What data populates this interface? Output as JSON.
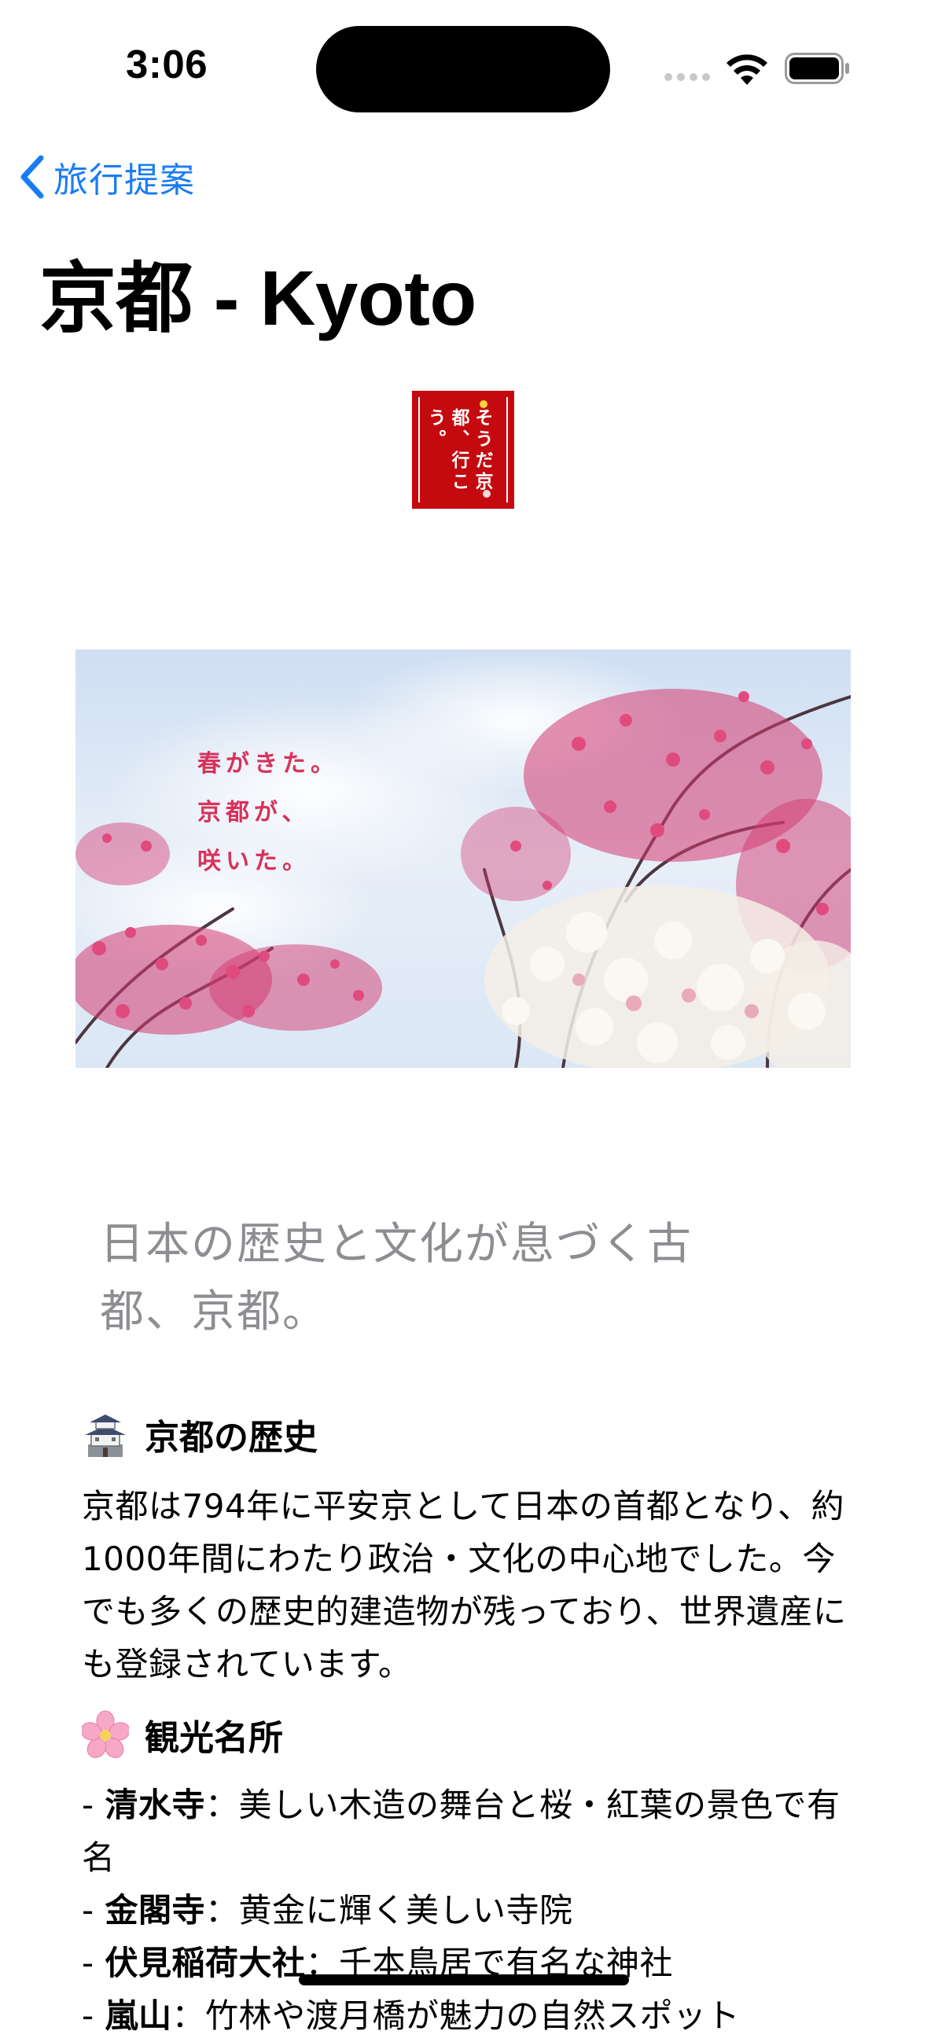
{
  "status_bar": {
    "time": "3:06"
  },
  "nav": {
    "back_label": "旅行提案"
  },
  "page": {
    "title": "京都 - Kyoto"
  },
  "logo": {
    "text": "そうだ京都、行こう。"
  },
  "hero": {
    "copy_lines": [
      "春がきた。",
      "京都が、",
      "咲いた。"
    ]
  },
  "lead": "日本の歴史と文化が息づく古都、京都。",
  "sections": [
    {
      "icon": "castle-icon",
      "heading": "京都の歴史",
      "body": "京都は794年に平安京として日本の首都となり、約1000年間にわたり政治・文化の中心地でした。今でも多くの歴史的建造物が残っており、世界遺産にも登録されています。"
    },
    {
      "icon": "cherry-blossom-icon",
      "heading": "観光名所",
      "items": [
        {
          "name": "清水寺",
          "desc": "：美しい木造の舞台と桜・紅葉の景色で有名"
        },
        {
          "name": "金閣寺",
          "desc": "：黄金に輝く美しい寺院"
        },
        {
          "name": "伏見稲荷大社",
          "desc": "：千本鳥居で有名な神社"
        },
        {
          "name": "嵐山",
          "desc": "：竹林や渡月橋が魅力の自然スポット"
        }
      ]
    }
  ],
  "colors": {
    "accent": "#1a7cf5",
    "logo_red": "#c4090f",
    "hero_copy": "#d8325a",
    "lead_gray": "#8d8d92"
  }
}
